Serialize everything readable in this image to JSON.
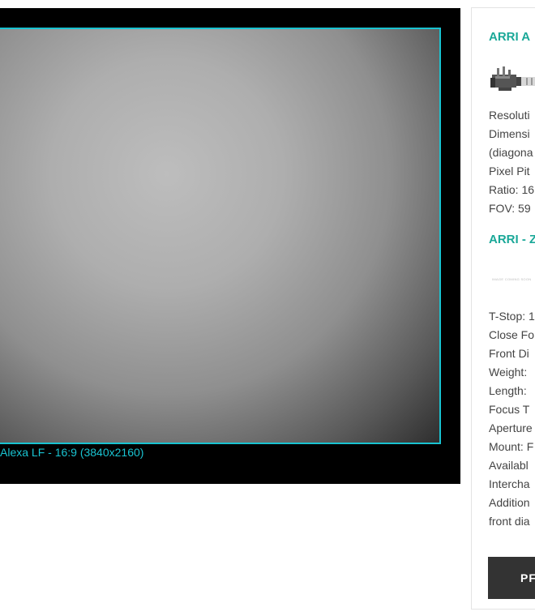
{
  "viewer": {
    "frame_label": "Alexa LF - 16:9 (3840x2160)",
    "frame_color": "#19c3d1"
  },
  "panel": {
    "camera_title": "ARRI A",
    "camera_specs": [
      "Resoluti",
      "Dimensi",
      "(diagona",
      "Pixel Pit",
      "Ratio: 16",
      "FOV: 59"
    ],
    "lens_title": "ARRI - Z",
    "lens_image_text": "IMAGE COMING SOON",
    "lens_specs": [
      "T-Stop: 1",
      "Close Fo",
      "Front Di",
      "Weight:",
      "Length:",
      "Focus T",
      "Aperture",
      "Mount: F",
      "Availabl",
      "Intercha",
      "Addition",
      "front dia"
    ],
    "button_label": "PF",
    "accent_color": "#1aa898"
  }
}
